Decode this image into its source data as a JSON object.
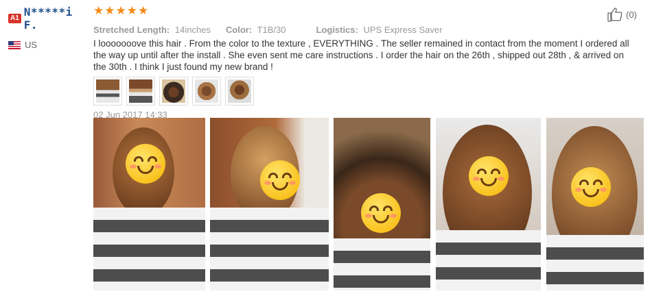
{
  "user": {
    "level_badge": "A1",
    "name": "N*****i F.",
    "country": "US"
  },
  "review": {
    "rating": 5,
    "stars": [
      "★",
      "★",
      "★",
      "★",
      "★"
    ],
    "attributes": [
      {
        "label": "Stretched Length:",
        "value": "14inches"
      },
      {
        "label": "Color:",
        "value": "T1B/30"
      },
      {
        "label": "Logistics:",
        "value": "UPS Express Saver"
      }
    ],
    "text": "I looooooove this hair . From the color to the texture , EVERYTHING . The seller remained in contact from the moment I ordered all the way up until after the install . She even sent me care instructions . I order the hair on the 26th , shipped out 28th , & arrived on the 30th . I think I just found my new brand !",
    "date": "02 Jun 2017 14:33",
    "helpful_count": "(0)"
  },
  "thumbnails": [
    {
      "name": "thumb-1"
    },
    {
      "name": "thumb-2"
    },
    {
      "name": "thumb-3"
    },
    {
      "name": "thumb-4"
    },
    {
      "name": "thumb-5"
    }
  ],
  "photos": [
    {
      "name": "photo-1"
    },
    {
      "name": "photo-2"
    },
    {
      "name": "photo-3"
    },
    {
      "name": "photo-4"
    },
    {
      "name": "photo-5"
    }
  ],
  "colors": {
    "star": "#f78a17",
    "badge": "#d6332a",
    "username": "#1f4f8b",
    "muted": "#999999"
  }
}
